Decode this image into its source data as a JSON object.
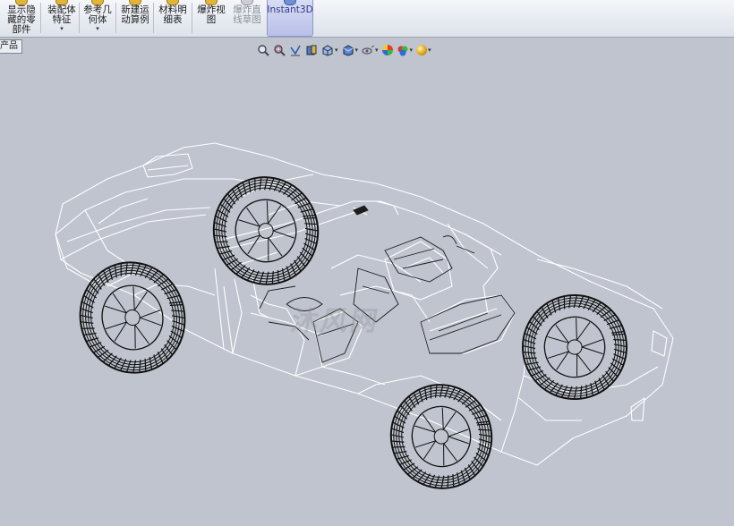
{
  "toolbar": {
    "buttons": [
      {
        "label": "显示隐\n藏的零\n部件",
        "dropdown": false,
        "enabled": true
      },
      {
        "label": "装配体\n特征",
        "dropdown": true,
        "enabled": true
      },
      {
        "label": "参考几\n何体",
        "dropdown": true,
        "enabled": true
      },
      {
        "label": "新建运\n动算例",
        "dropdown": false,
        "enabled": true
      },
      {
        "label": "材料明\n细表",
        "dropdown": false,
        "enabled": true
      },
      {
        "label": "爆炸视\n图",
        "dropdown": false,
        "enabled": true
      },
      {
        "label": "爆炸直\n线草图",
        "dropdown": false,
        "enabled": false
      },
      {
        "label": "Instant3D",
        "dropdown": false,
        "enabled": true,
        "active": true
      }
    ],
    "dropdown_glyph": "▾"
  },
  "command_tab": {
    "label": "产品"
  },
  "heads_up_toolbar": {
    "icons": [
      "zoom-to-fit-icon",
      "zoom-to-area-icon",
      "previous-view-icon",
      "section-view-icon",
      "view-orientation-icon",
      "display-style-icon",
      "hide-show-items-icon",
      "edit-appearance-icon",
      "apply-scene-icon",
      "view-settings-icon"
    ]
  },
  "viewport": {
    "watermark": "沐风网",
    "background": "#bfc4cf",
    "wireframe_color": "#ffffff",
    "tire_color": "#111111"
  }
}
